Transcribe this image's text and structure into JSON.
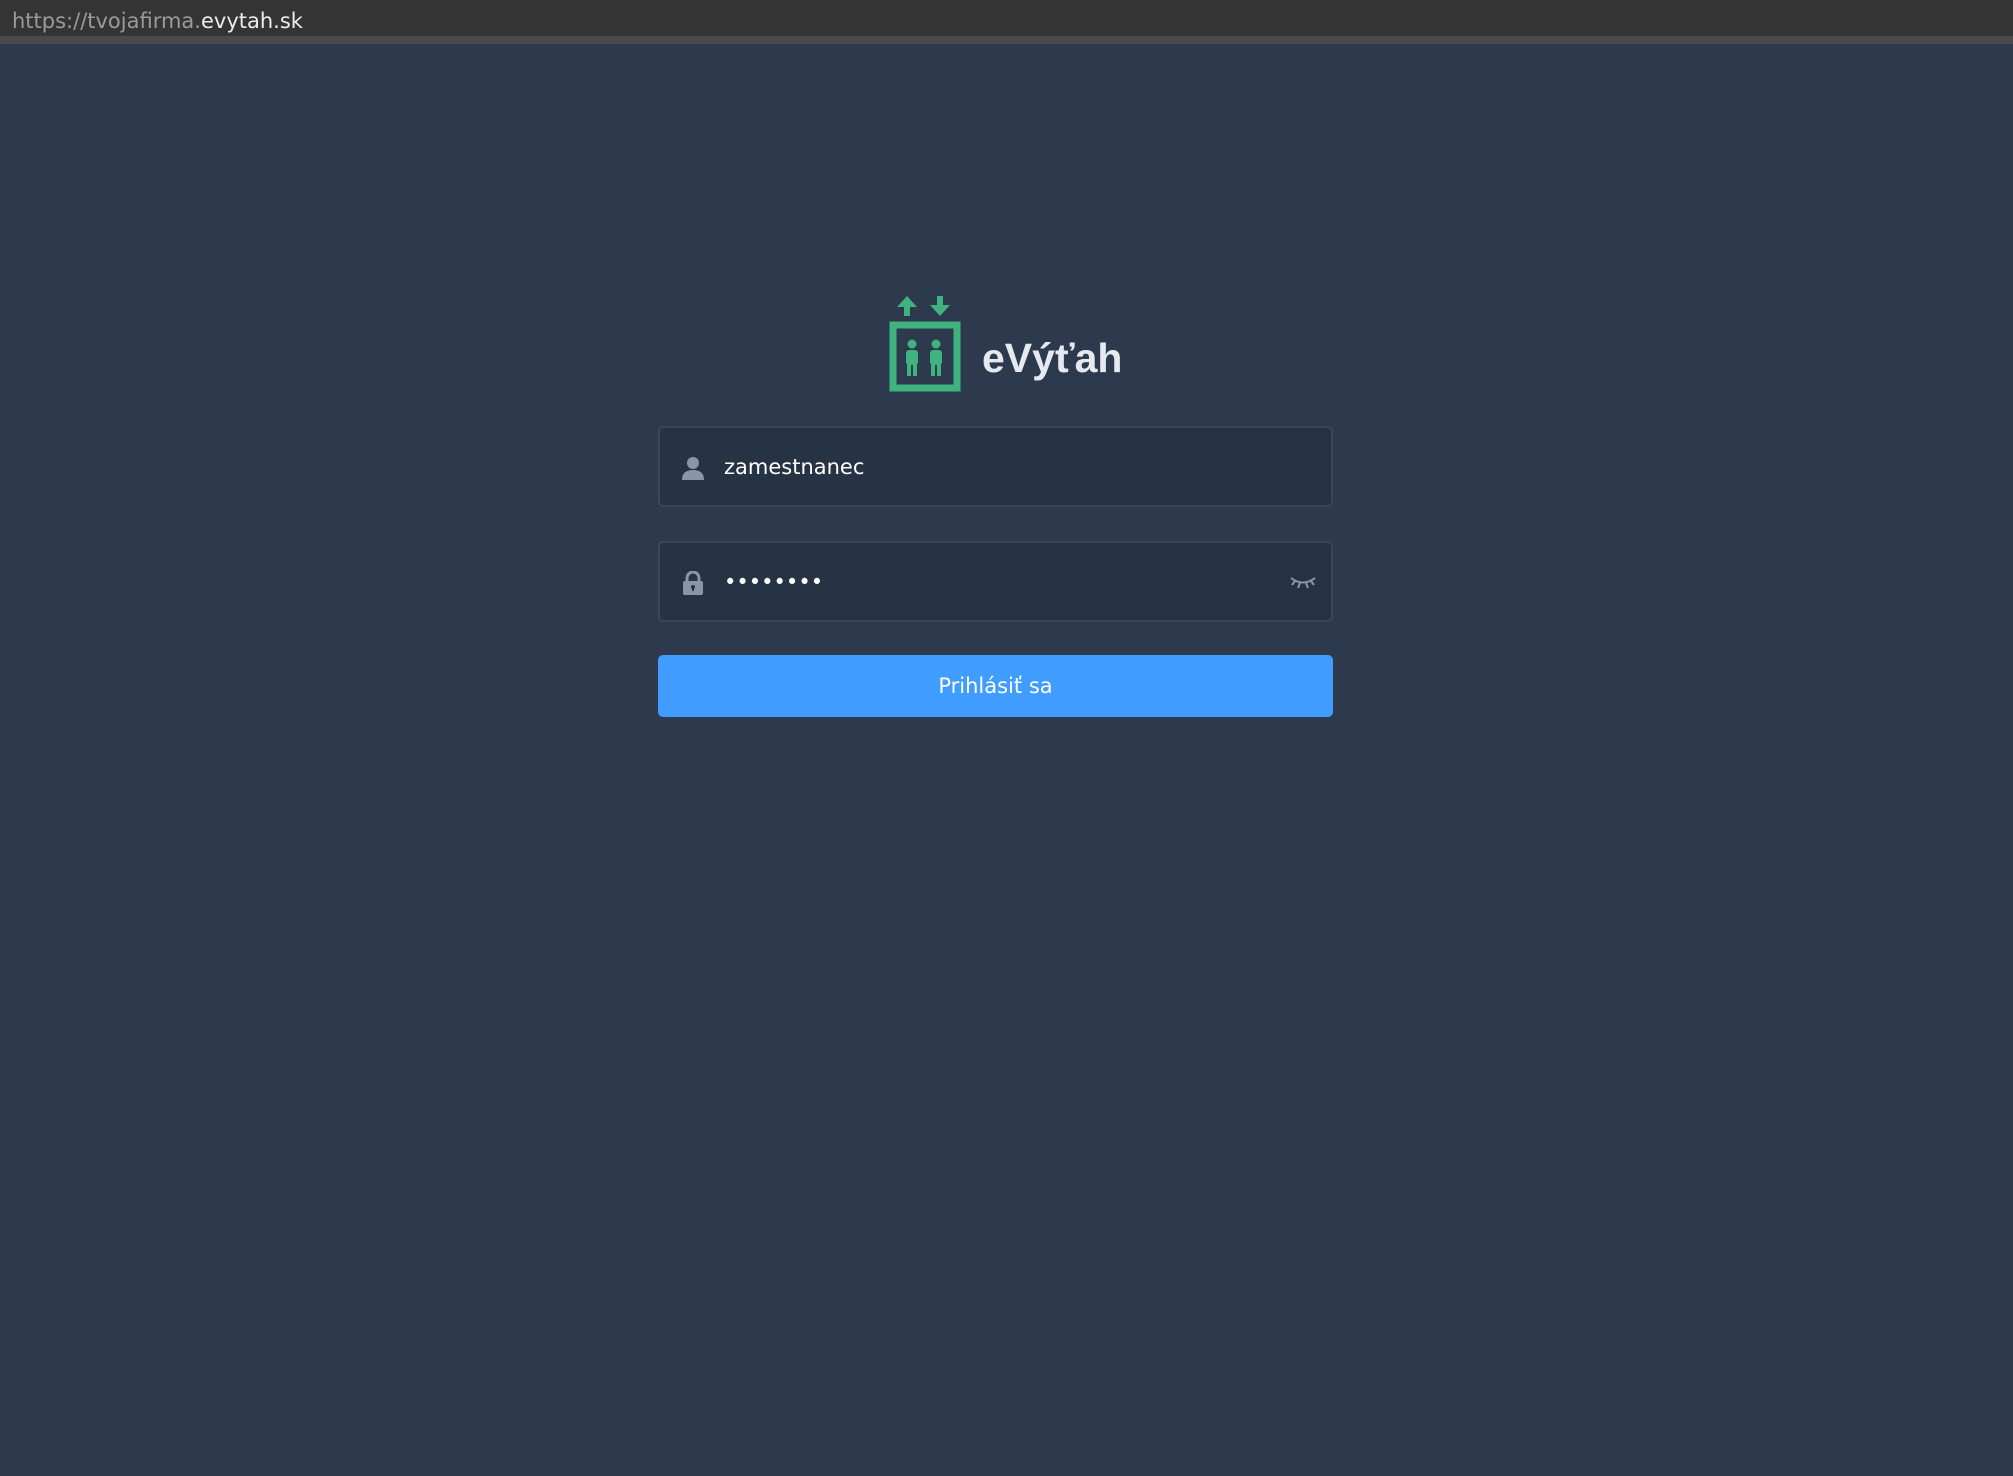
{
  "browser": {
    "url_prefix": "https://tvojafirma.",
    "url_domain": "evytah.sk"
  },
  "brand": {
    "name": "eVýťah",
    "logo_color": "#3fb27f"
  },
  "login": {
    "username_value": "zamestnanec",
    "password_value": "••••••••",
    "submit_label": "Prihlásiť sa",
    "button_color": "#409cff"
  },
  "icons": {
    "username": "user-icon",
    "password": "lock-icon",
    "toggle": "eye-closed-icon"
  }
}
